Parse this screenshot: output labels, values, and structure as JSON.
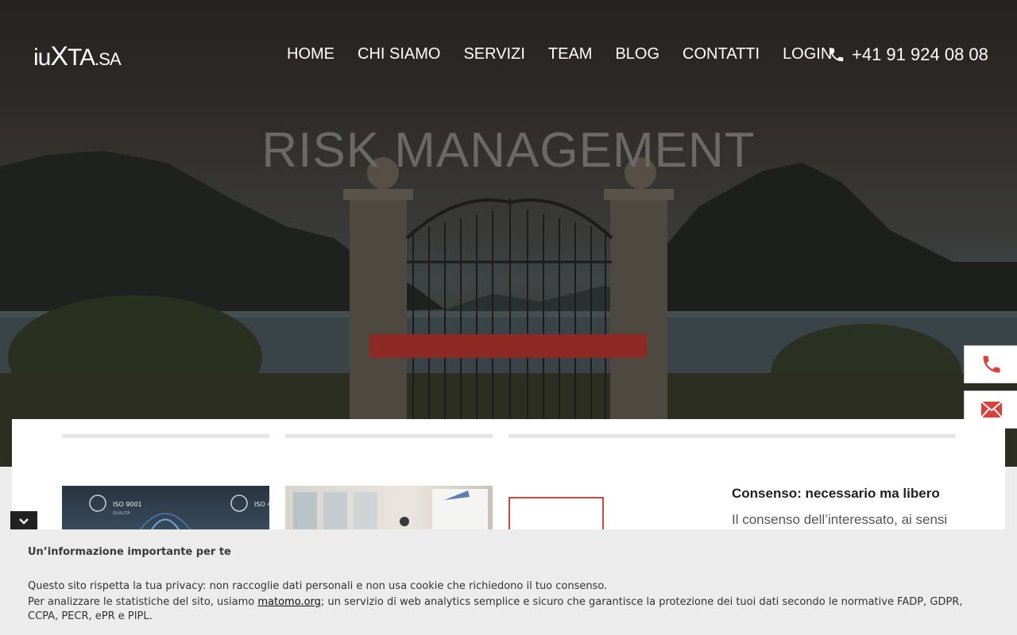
{
  "header": {
    "logo": {
      "pre": "iu",
      "x": "X",
      "mid": "TA",
      "sa": ".SA"
    },
    "nav": [
      "HOME",
      "CHI SIAMO",
      "SERVIZI",
      "TEAM",
      "BLOG",
      "CONTATTI",
      "LOGIN"
    ],
    "phone": "+41 91 924 08 08"
  },
  "hero": {
    "title": "RISK MANAGEMENT"
  },
  "article": {
    "title": "Consenso: necessario ma libero",
    "excerpt": "Il consenso dell’interessato, ai sensi"
  },
  "thumb1": {
    "badge_left": "ISO 9001",
    "badge_left_sub": "QUALITÀ",
    "badge_right": "ISO 4"
  },
  "cookie": {
    "title": "Un’informazione importante per te",
    "line1": "Questo sito rispetta la tua privacy: non raccoglie dati personali e non usa cookie che richiedono il tuo consenso.",
    "line2_pre": "Per analizzare le statistiche del sito, usiamo ",
    "link": "matomo.org",
    "line2_post": "; un servizio di web analytics semplice e sicuro che garantisce la protezione dei tuoi dati secondo le normative FADP, GDPR, CCPA, PECR, ePR e PIPL."
  },
  "colors": {
    "accent": "#d9413a",
    "hero_button": "#8d2a25"
  },
  "icons": [
    "phone-icon",
    "mail-icon",
    "chevron-down-icon"
  ]
}
